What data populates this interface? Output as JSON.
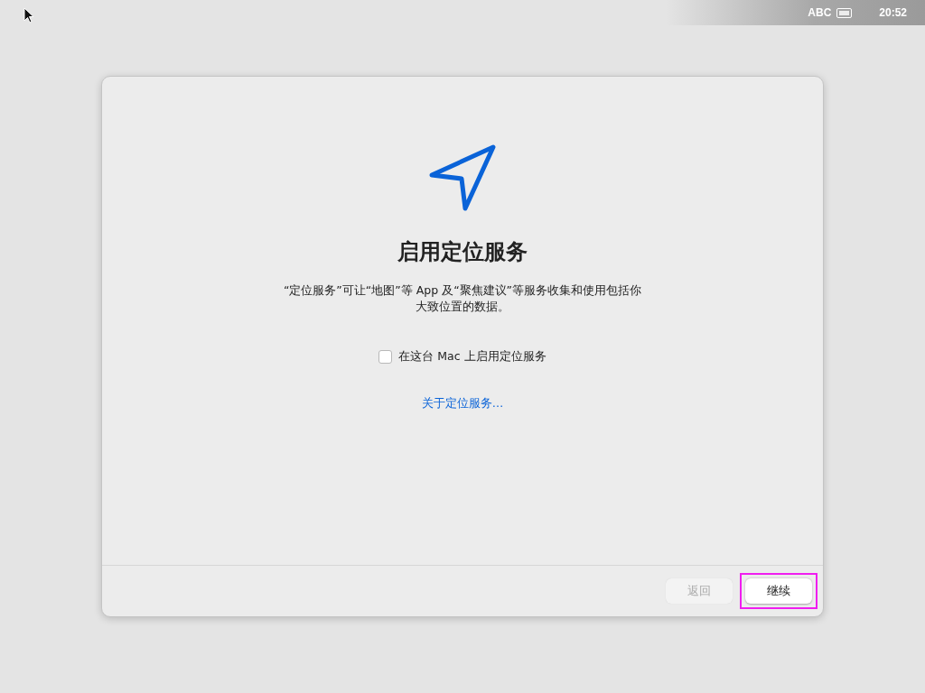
{
  "menu_bar": {
    "input_source": "ABC",
    "time": "20:52"
  },
  "dialog": {
    "title": "启用定位服务",
    "description": "“定位服务”可让“地图”等 App 及“聚焦建议”等服务收集和使用包括你大致位置的数据。",
    "checkbox": {
      "label": "在这台 Mac 上启用定位服务",
      "checked": false
    },
    "link": "关于定位服务…",
    "buttons": [
      {
        "label": "返回",
        "disabled": true,
        "highlighted": false
      },
      {
        "label": "继续",
        "disabled": false,
        "highlighted": true
      }
    ]
  }
}
